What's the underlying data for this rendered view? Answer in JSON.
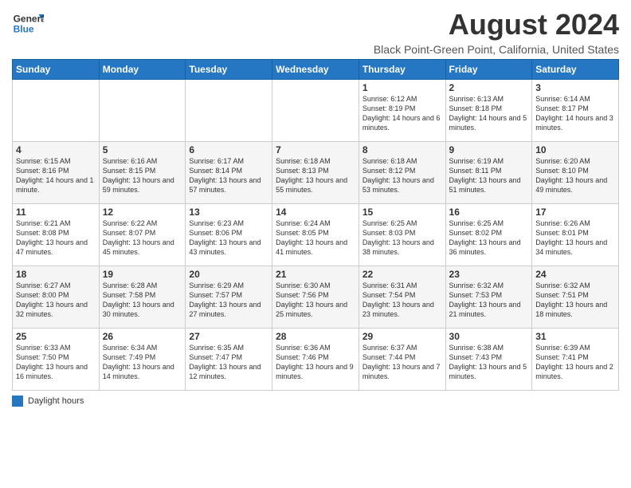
{
  "header": {
    "logo_line1": "General",
    "logo_line2": "Blue",
    "month_title": "August 2024",
    "location": "Black Point-Green Point, California, United States"
  },
  "weekdays": [
    "Sunday",
    "Monday",
    "Tuesday",
    "Wednesday",
    "Thursday",
    "Friday",
    "Saturday"
  ],
  "weeks": [
    [
      {
        "day": "",
        "info": ""
      },
      {
        "day": "",
        "info": ""
      },
      {
        "day": "",
        "info": ""
      },
      {
        "day": "",
        "info": ""
      },
      {
        "day": "1",
        "info": "Sunrise: 6:12 AM\nSunset: 8:19 PM\nDaylight: 14 hours\nand 6 minutes."
      },
      {
        "day": "2",
        "info": "Sunrise: 6:13 AM\nSunset: 8:18 PM\nDaylight: 14 hours\nand 5 minutes."
      },
      {
        "day": "3",
        "info": "Sunrise: 6:14 AM\nSunset: 8:17 PM\nDaylight: 14 hours\nand 3 minutes."
      }
    ],
    [
      {
        "day": "4",
        "info": "Sunrise: 6:15 AM\nSunset: 8:16 PM\nDaylight: 14 hours\nand 1 minute."
      },
      {
        "day": "5",
        "info": "Sunrise: 6:16 AM\nSunset: 8:15 PM\nDaylight: 13 hours\nand 59 minutes."
      },
      {
        "day": "6",
        "info": "Sunrise: 6:17 AM\nSunset: 8:14 PM\nDaylight: 13 hours\nand 57 minutes."
      },
      {
        "day": "7",
        "info": "Sunrise: 6:18 AM\nSunset: 8:13 PM\nDaylight: 13 hours\nand 55 minutes."
      },
      {
        "day": "8",
        "info": "Sunrise: 6:18 AM\nSunset: 8:12 PM\nDaylight: 13 hours\nand 53 minutes."
      },
      {
        "day": "9",
        "info": "Sunrise: 6:19 AM\nSunset: 8:11 PM\nDaylight: 13 hours\nand 51 minutes."
      },
      {
        "day": "10",
        "info": "Sunrise: 6:20 AM\nSunset: 8:10 PM\nDaylight: 13 hours\nand 49 minutes."
      }
    ],
    [
      {
        "day": "11",
        "info": "Sunrise: 6:21 AM\nSunset: 8:08 PM\nDaylight: 13 hours\nand 47 minutes."
      },
      {
        "day": "12",
        "info": "Sunrise: 6:22 AM\nSunset: 8:07 PM\nDaylight: 13 hours\nand 45 minutes."
      },
      {
        "day": "13",
        "info": "Sunrise: 6:23 AM\nSunset: 8:06 PM\nDaylight: 13 hours\nand 43 minutes."
      },
      {
        "day": "14",
        "info": "Sunrise: 6:24 AM\nSunset: 8:05 PM\nDaylight: 13 hours\nand 41 minutes."
      },
      {
        "day": "15",
        "info": "Sunrise: 6:25 AM\nSunset: 8:03 PM\nDaylight: 13 hours\nand 38 minutes."
      },
      {
        "day": "16",
        "info": "Sunrise: 6:25 AM\nSunset: 8:02 PM\nDaylight: 13 hours\nand 36 minutes."
      },
      {
        "day": "17",
        "info": "Sunrise: 6:26 AM\nSunset: 8:01 PM\nDaylight: 13 hours\nand 34 minutes."
      }
    ],
    [
      {
        "day": "18",
        "info": "Sunrise: 6:27 AM\nSunset: 8:00 PM\nDaylight: 13 hours\nand 32 minutes."
      },
      {
        "day": "19",
        "info": "Sunrise: 6:28 AM\nSunset: 7:58 PM\nDaylight: 13 hours\nand 30 minutes."
      },
      {
        "day": "20",
        "info": "Sunrise: 6:29 AM\nSunset: 7:57 PM\nDaylight: 13 hours\nand 27 minutes."
      },
      {
        "day": "21",
        "info": "Sunrise: 6:30 AM\nSunset: 7:56 PM\nDaylight: 13 hours\nand 25 minutes."
      },
      {
        "day": "22",
        "info": "Sunrise: 6:31 AM\nSunset: 7:54 PM\nDaylight: 13 hours\nand 23 minutes."
      },
      {
        "day": "23",
        "info": "Sunrise: 6:32 AM\nSunset: 7:53 PM\nDaylight: 13 hours\nand 21 minutes."
      },
      {
        "day": "24",
        "info": "Sunrise: 6:32 AM\nSunset: 7:51 PM\nDaylight: 13 hours\nand 18 minutes."
      }
    ],
    [
      {
        "day": "25",
        "info": "Sunrise: 6:33 AM\nSunset: 7:50 PM\nDaylight: 13 hours\nand 16 minutes."
      },
      {
        "day": "26",
        "info": "Sunrise: 6:34 AM\nSunset: 7:49 PM\nDaylight: 13 hours\nand 14 minutes."
      },
      {
        "day": "27",
        "info": "Sunrise: 6:35 AM\nSunset: 7:47 PM\nDaylight: 13 hours\nand 12 minutes."
      },
      {
        "day": "28",
        "info": "Sunrise: 6:36 AM\nSunset: 7:46 PM\nDaylight: 13 hours\nand 9 minutes."
      },
      {
        "day": "29",
        "info": "Sunrise: 6:37 AM\nSunset: 7:44 PM\nDaylight: 13 hours\nand 7 minutes."
      },
      {
        "day": "30",
        "info": "Sunrise: 6:38 AM\nSunset: 7:43 PM\nDaylight: 13 hours\nand 5 minutes."
      },
      {
        "day": "31",
        "info": "Sunrise: 6:39 AM\nSunset: 7:41 PM\nDaylight: 13 hours\nand 2 minutes."
      }
    ]
  ],
  "legend": {
    "daylight_label": "Daylight hours"
  }
}
